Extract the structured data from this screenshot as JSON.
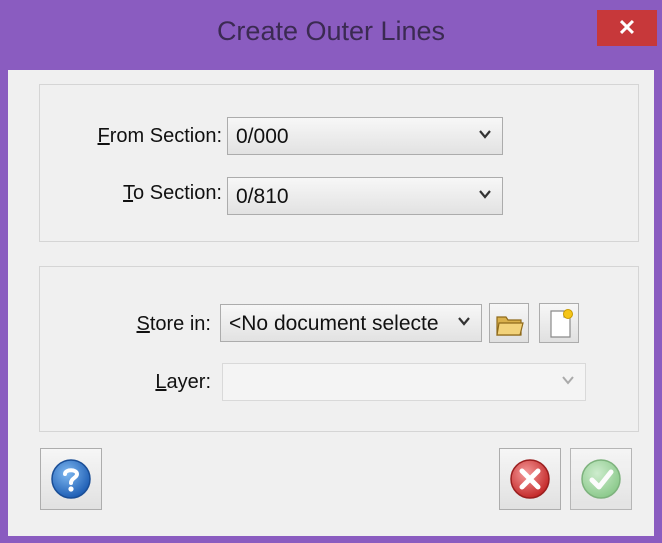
{
  "window": {
    "title": "Create Outer Lines",
    "close_glyph": "✕"
  },
  "section_group": {
    "from_label_key": "F",
    "from_label_rest": "rom Section:",
    "from_value": "0/000",
    "to_label_key": "T",
    "to_label_rest": "o Section:",
    "to_value": "0/810"
  },
  "store_group": {
    "store_label_key": "S",
    "store_label_rest": "tore in:",
    "store_value": "<No document selecte",
    "layer_label_key": "L",
    "layer_label_rest": "ayer:",
    "layer_value": ""
  },
  "icons": {
    "dropdown": "chevron-down-icon",
    "open_folder": "folder-icon",
    "new_document": "new-document-icon",
    "help": "help-icon",
    "cancel": "cancel-icon",
    "ok": "ok-icon"
  },
  "colors": {
    "titlebar": "#8a5cc0",
    "close": "#c7383a",
    "help": "#2b74c8",
    "cancel": "#d43d3d",
    "ok_disabled": "#8fd08f"
  }
}
